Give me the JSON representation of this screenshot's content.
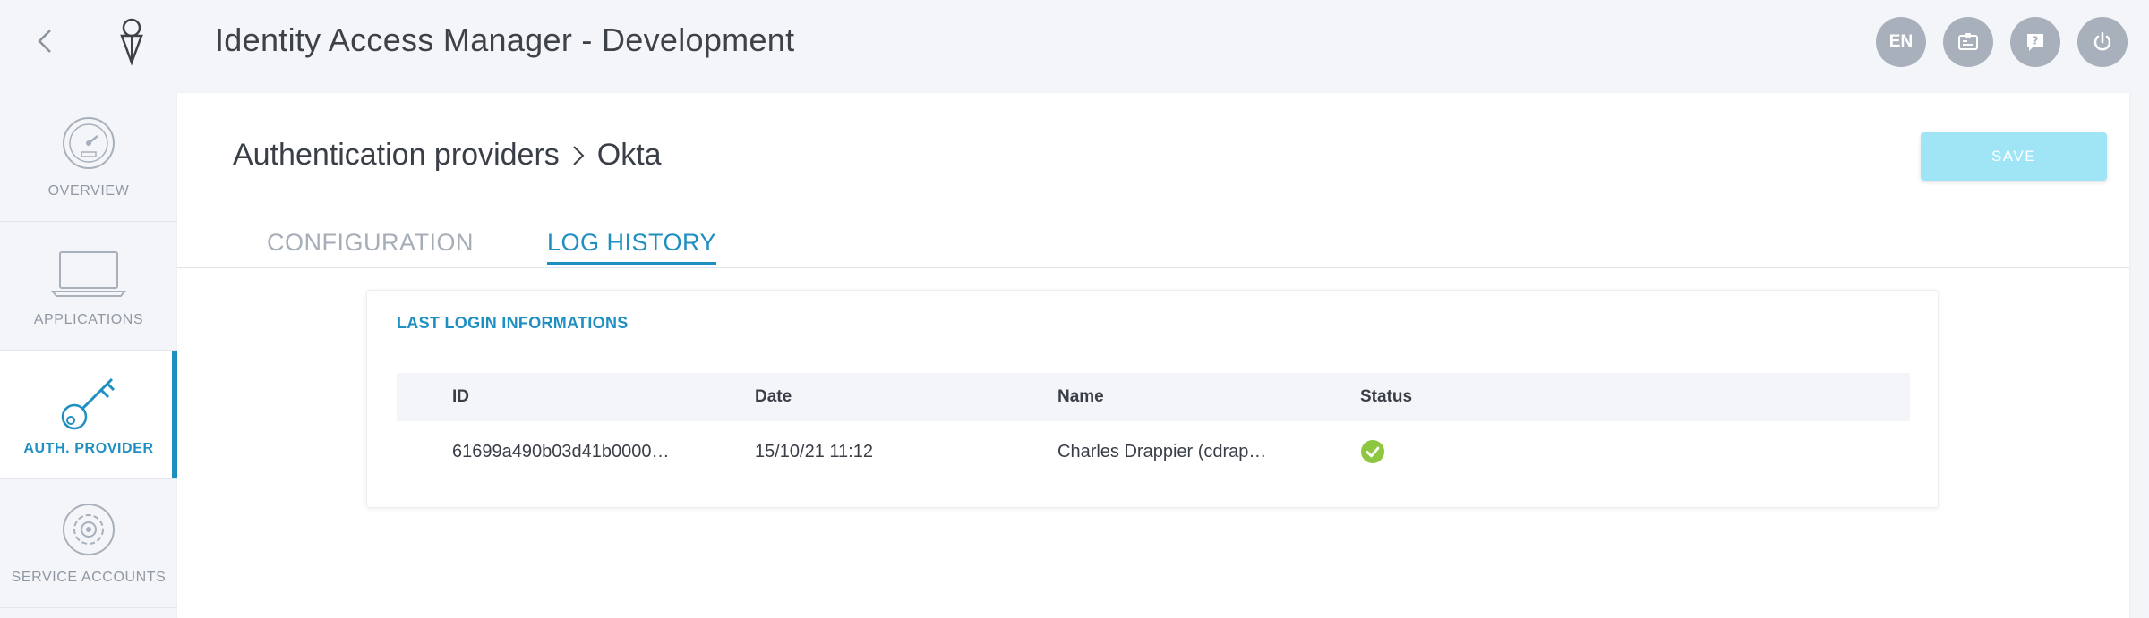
{
  "app": {
    "title": "Identity Access Manager - Development"
  },
  "header_actions": {
    "language_label": "EN",
    "icons": [
      "id-card-icon",
      "help-icon",
      "power-icon"
    ]
  },
  "sidebar": {
    "items": [
      {
        "label": "OVERVIEW",
        "icon": "speedometer-icon",
        "active": false
      },
      {
        "label": "APPLICATIONS",
        "icon": "laptop-icon",
        "active": false
      },
      {
        "label": "AUTH. PROVIDER",
        "icon": "key-icon",
        "active": true
      },
      {
        "label": "SERVICE ACCOUNTS",
        "icon": "gear-icon",
        "active": false
      }
    ]
  },
  "breadcrumb": {
    "parent": "Authentication providers",
    "current": "Okta"
  },
  "toolbar": {
    "save_label": "SAVE",
    "save_disabled": true
  },
  "tabs": [
    {
      "label": "CONFIGURATION",
      "active": false
    },
    {
      "label": "LOG HISTORY",
      "active": true
    }
  ],
  "login_card": {
    "title": "LAST LOGIN INFORMATIONS",
    "columns": [
      "ID",
      "Date",
      "Name",
      "Status"
    ],
    "rows": [
      {
        "id": "61699a490b03d41b0000…",
        "date": "15/10/21 11:12",
        "name": "Charles Drappier (cdrap…",
        "status": "success"
      }
    ]
  },
  "colors": {
    "accent": "#1f8fc2",
    "save_disabled": "#9fe5f6",
    "success": "#8dc63f",
    "header_circle": "#a7b0bb"
  }
}
